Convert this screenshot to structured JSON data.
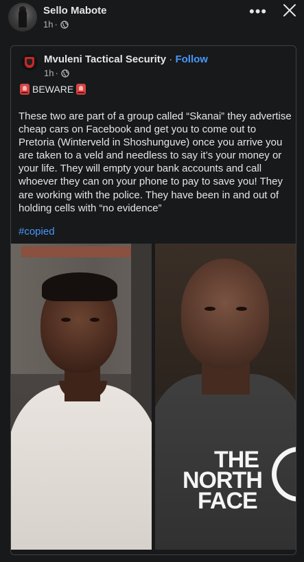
{
  "post": {
    "author": "Sello Mabote",
    "time": "1h",
    "separator": "·",
    "more_label": "•••",
    "icons": {
      "privacy": "globe-icon",
      "close": "close-icon",
      "more": "more-icon"
    }
  },
  "shared": {
    "page_name": "Mvuleni Tactical Security",
    "separator": "·",
    "follow_label": "Follow",
    "time": "1h",
    "beware": "BEWARE",
    "body": "These two are part of a group called “Skanai” they advertise cheap cars on Facebook and get you to come out to Pretoria (Winterveld in Shoshunguve) once you arrive you are taken to a veld and needless to say it’s your money or your life. They will empty your bank accounts and call whoever they can on your phone to pay to save you! They are working with the police. They have been in and out of holding cells with “no evidence”",
    "hashtag": "#copied",
    "shirt_logo": {
      "line1": "THE",
      "line2": "NORTH",
      "line3": "FACE"
    }
  },
  "colors": {
    "background": "#18191a",
    "text": "#e4e6eb",
    "muted": "#b0b3b8",
    "link": "#4599ff",
    "border": "#3e4042",
    "alarm": "#d64545"
  }
}
